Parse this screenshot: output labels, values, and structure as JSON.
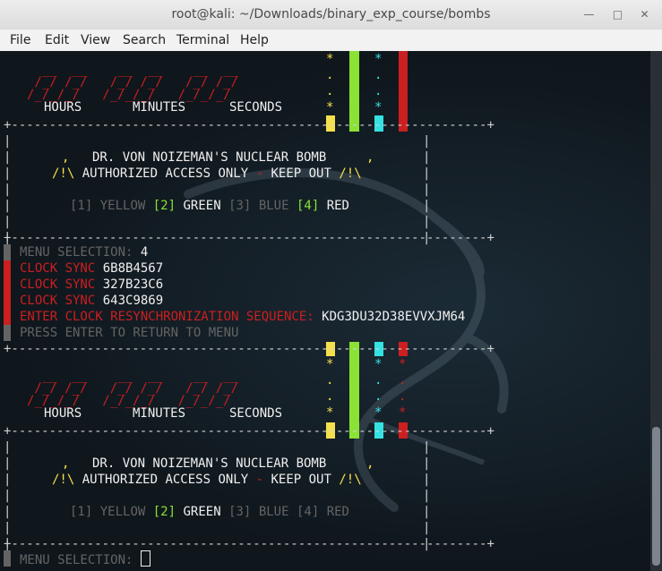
{
  "window": {
    "title": "root@kali: ~/Downloads/binary_exp_course/bombs"
  },
  "menubar": [
    "File",
    "Edit",
    "View",
    "Search",
    "Terminal",
    "Help"
  ],
  "timer_labels": [
    "HOURS",
    "MINUTES",
    "SECONDS"
  ],
  "bomb": {
    "header": "DR. VON NOIZEMAN'S NUCLEAR BOMB",
    "warn_prefix": "/!\\",
    "warn_text": "AUTHORIZED ACCESS ONLY",
    "warn_dash": "-",
    "warn_keep": "KEEP OUT",
    "warn_suffix": "/!\\",
    "comma": ","
  },
  "wires_top": {
    "opt1_num": "[1]",
    "opt1": "YELLOW",
    "opt2_num": "[2]",
    "opt2": "GREEN",
    "opt3_num": "[3]",
    "opt3": "BLUE",
    "opt4_num": "[4]",
    "opt4": "RED"
  },
  "wires_bottom": {
    "opt1_num": "[1]",
    "opt1": "YELLOW",
    "opt2_num": "[2]",
    "opt2": "GREEN",
    "opt3_num": "[3]",
    "opt3": "BLUE",
    "opt4_num": "[4]",
    "opt4": "RED"
  },
  "session": {
    "menu_label": "MENU SELECTION:",
    "menu_value": "4",
    "clock_label": "CLOCK SYNC",
    "clock_values": [
      "6B8B4567",
      "327B23C6",
      "643C9869"
    ],
    "resync_label": "ENTER CLOCK RESYNCHRONIZATION SEQUENCE:",
    "resync_value": "KDG3DU32D38EVVXJM64",
    "press_enter": "PRESS ENTER TO RETURN TO MENU",
    "prompt_label": "MENU SELECTION:"
  },
  "colors": {
    "yellow": "#f4e04d",
    "green": "#8ae234",
    "blue": "#34e2e2",
    "red": "#cc1f1f",
    "gray": "#646464"
  }
}
